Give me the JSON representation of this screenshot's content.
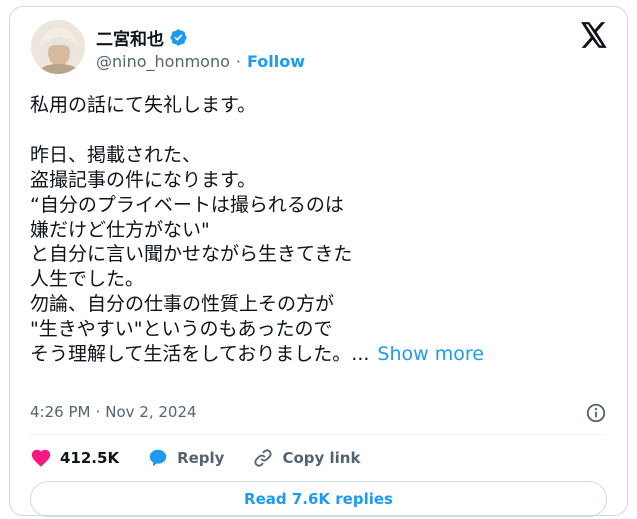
{
  "author": {
    "display_name": "二宮和也",
    "handle": "@nino_honmono",
    "separator": "·",
    "follow_label": "Follow",
    "verified_color": "#1d9bf0"
  },
  "tweet": {
    "text": "私用の話にて失礼します。\n\n昨日、掲載された、\n盗撮記事の件になります。\n“自分のプライベートは撮られるのは\n嫌だけど仕方がない\"\nと自分に言い聞かせながら生きてきた\n人生でした。\n勿論、自分の仕事の性質上その方が\n\"生きやすい\"というのもあったので\nそう理解して生活をしておりました。...",
    "show_more_label": "Show more",
    "time": "4:26 PM",
    "separator": "·",
    "date": "Nov 2, 2024"
  },
  "actions": {
    "likes": "412.5K",
    "reply_label": "Reply",
    "copy_link_label": "Copy link",
    "read_replies_label": "Read 7.6K replies"
  },
  "colors": {
    "accent": "#1d9bf0",
    "like": "#f91880",
    "text": "#0f1419",
    "muted": "#536471",
    "border": "#cfd9de"
  },
  "icons": [
    "x-logo-icon",
    "verified-badge-icon",
    "info-icon",
    "heart-icon",
    "reply-icon",
    "link-icon"
  ]
}
